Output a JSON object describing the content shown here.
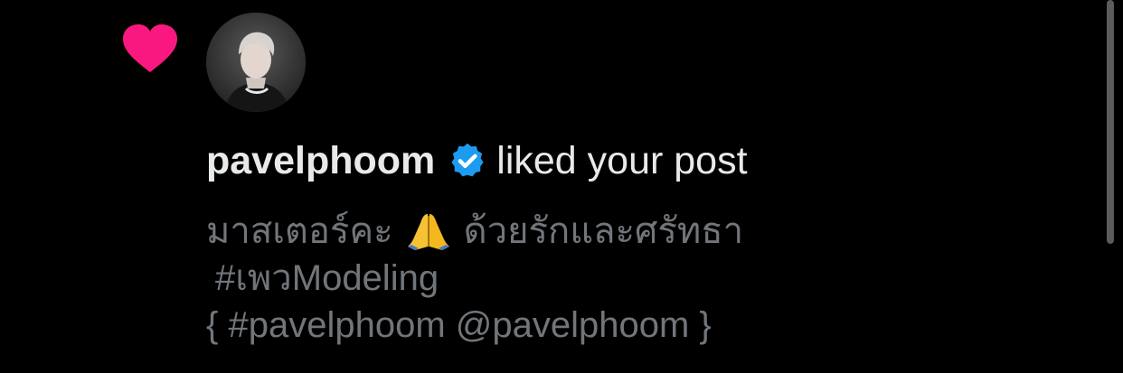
{
  "notification": {
    "type_icon": "heart-icon",
    "username": "pavelphoom",
    "verified_icon": "verified-badge-icon",
    "action": "liked your post",
    "post_lines": [
      "มาสเตอร์คะ",
      "ด้วยรักและศรัทธา",
      "#เพวModeling",
      "{ #pavelphoom @pavelphoom }"
    ],
    "post_emoji": "🙏"
  },
  "colors": {
    "background": "#000000",
    "like_pink": "#f91880",
    "verified_blue": "#1d9bf0",
    "primary_text": "#e7e9ea",
    "secondary_text": "#71767b"
  }
}
